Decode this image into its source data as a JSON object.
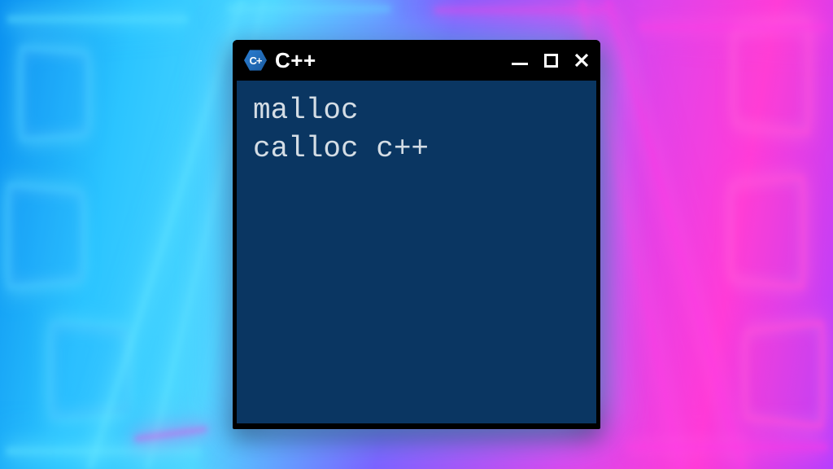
{
  "window": {
    "title": "C++",
    "icon_label": "C++",
    "controls": {
      "minimize": "minimize",
      "maximize": "maximize",
      "close": "close"
    }
  },
  "terminal": {
    "lines": [
      "malloc",
      "calloc c++"
    ]
  }
}
